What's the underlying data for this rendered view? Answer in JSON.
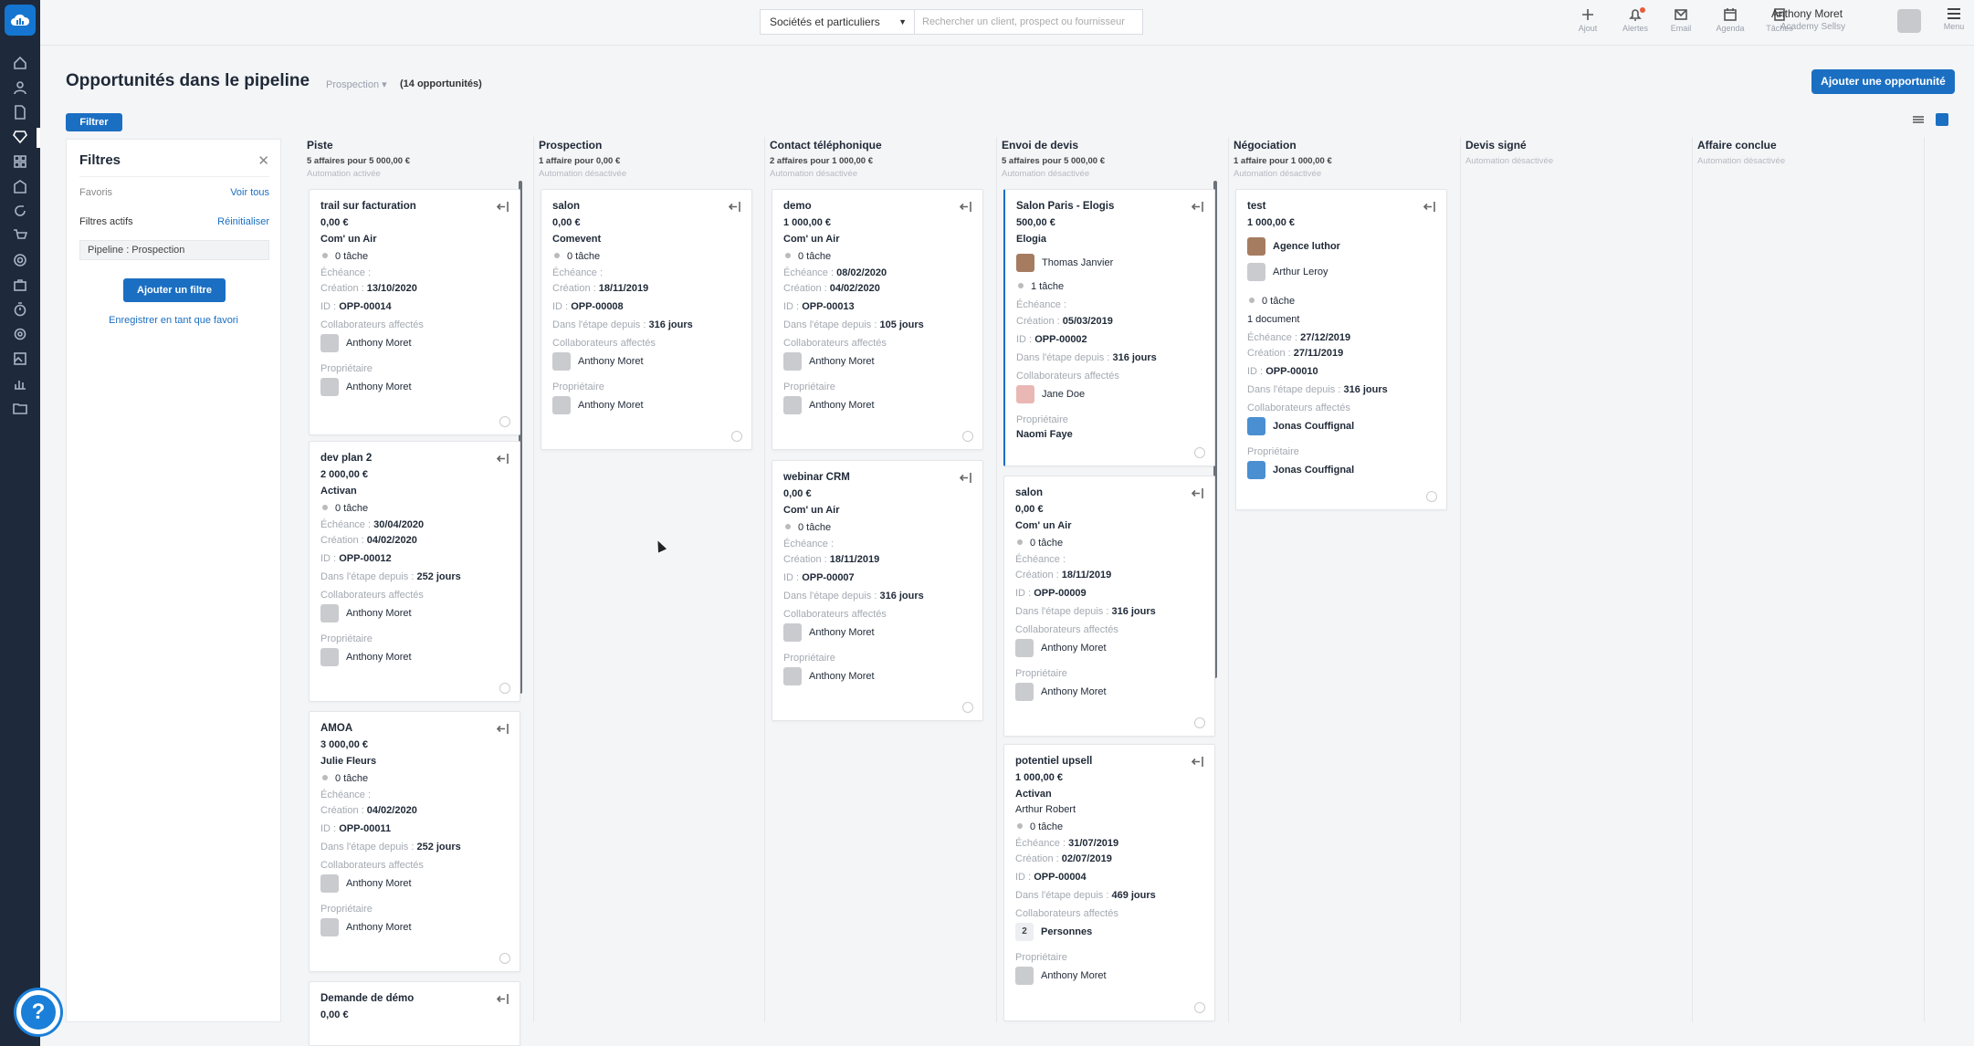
{
  "topbar": {
    "scope_select": "Sociétés et particuliers",
    "search_placeholder": "Rechercher un client, prospect ou fournisseur",
    "buttons": [
      {
        "label": "Ajout",
        "icon": "plus-icon"
      },
      {
        "label": "Alertes",
        "icon": "bell-icon"
      },
      {
        "label": "Email",
        "icon": "mail-icon"
      },
      {
        "label": "Agenda",
        "icon": "calendar-icon"
      },
      {
        "label": "Tâches",
        "icon": "tasks-icon"
      }
    ],
    "user_name": "Anthony Moret",
    "user_sub": "Academy Sellsy",
    "menu_label": "Menu"
  },
  "page": {
    "title": "Opportunités dans le pipeline",
    "pipeline_select": "Prospection",
    "count": "(14 opportunités)",
    "add_button": "Ajouter une opportunité",
    "filter_button": "Filtrer"
  },
  "filters": {
    "title": "Filtres",
    "favorites_label": "Favoris",
    "see_all": "Voir tous",
    "active_label": "Filtres actifs",
    "reset": "Réinitialiser",
    "active_tag": "Pipeline : Prospection",
    "add_filter": "Ajouter un filtre",
    "save_favorite": "Enregistrer en tant que favori"
  },
  "labels": {
    "tasks": "0 tâche",
    "one_task": "1 tâche",
    "echeance": "Échéance :",
    "creation": "Création :",
    "id": "ID :",
    "stage_since": "Dans l'étape depuis :",
    "collaborators": "Collaborateurs affectés",
    "owner": "Propriétaire",
    "one_document": "1 document"
  },
  "columns": [
    {
      "name": "Piste",
      "stats": "5 affaires pour 5 000,00 €",
      "auto": "Automation activée"
    },
    {
      "name": "Prospection",
      "stats": "1 affaire pour 0,00 €",
      "auto": "Automation désactivée"
    },
    {
      "name": "Contact téléphonique",
      "stats": "2 affaires pour 1 000,00 €",
      "auto": "Automation désactivée"
    },
    {
      "name": "Envoi de devis",
      "stats": "5 affaires pour 5 000,00 €",
      "auto": "Automation désactivée"
    },
    {
      "name": "Négociation",
      "stats": "1 affaire pour 1 000,00 €",
      "auto": "Automation désactivée"
    },
    {
      "name": "Devis signé",
      "stats": "",
      "auto": "Automation désactivée"
    },
    {
      "name": "Affaire conclue",
      "stats": "",
      "auto": "Automation désactivée"
    }
  ],
  "cards": {
    "c1": {
      "title": "trail sur facturation",
      "amount": "0,00 €",
      "company": "Com' un Air",
      "creation": "13/10/2020",
      "id": "OPP-00014",
      "collab": "Anthony Moret",
      "owner": "Anthony Moret"
    },
    "c2": {
      "title": "dev plan 2",
      "amount": "2 000,00 €",
      "company": "Activan",
      "echeance": "30/04/2020",
      "creation": "04/02/2020",
      "id": "OPP-00012",
      "since": "252 jours",
      "collab": "Anthony Moret",
      "owner": "Anthony Moret"
    },
    "c3": {
      "title": "AMOA",
      "amount": "3 000,00 €",
      "company": "Julie Fleurs",
      "creation": "04/02/2020",
      "id": "OPP-00011",
      "since": "252 jours",
      "collab": "Anthony Moret",
      "owner": "Anthony Moret"
    },
    "c4": {
      "title": "Demande de démo",
      "amount": "0,00 €"
    },
    "p1": {
      "title": "salon",
      "amount": "0,00 €",
      "company": "Comevent",
      "creation": "18/11/2019",
      "id": "OPP-00008",
      "since": "316 jours",
      "collab": "Anthony Moret",
      "owner": "Anthony Moret"
    },
    "t1": {
      "title": "demo",
      "amount": "1 000,00 €",
      "company": "Com' un Air",
      "echeance": "08/02/2020",
      "creation": "04/02/2020",
      "id": "OPP-00013",
      "since": "105 jours",
      "collab": "Anthony Moret",
      "owner": "Anthony Moret"
    },
    "t2": {
      "title": "webinar CRM",
      "amount": "0,00 €",
      "company": "Com' un Air",
      "creation": "18/11/2019",
      "id": "OPP-00007",
      "since": "316 jours",
      "collab": "Anthony Moret",
      "owner": "Anthony Moret"
    },
    "d1": {
      "title": "Salon Paris - Elogis",
      "amount": "500,00 €",
      "company": "Elogia",
      "contact": "Thomas Janvier",
      "creation": "05/03/2019",
      "id": "OPP-00002",
      "since": "316 jours",
      "collab": "Jane Doe",
      "owner": "Naomi Faye"
    },
    "d2": {
      "title": "salon",
      "amount": "0,00 €",
      "company": "Com' un Air",
      "creation": "18/11/2019",
      "id": "OPP-00009",
      "since": "316 jours",
      "collab": "Anthony Moret",
      "owner": "Anthony Moret"
    },
    "d3": {
      "title": "potentiel upsell",
      "amount": "1 000,00 €",
      "company": "Activan",
      "contact": "Arthur Robert",
      "echeance": "31/07/2019",
      "creation": "02/07/2019",
      "id": "OPP-00004",
      "since": "469 jours",
      "collab_count": "2",
      "collab": "Personnes",
      "owner": "Anthony Moret"
    },
    "n1": {
      "title": "test",
      "amount": "1 000,00 €",
      "company": "Agence luthor",
      "contact": "Arthur Leroy",
      "echeance": "27/12/2019",
      "creation": "27/11/2019",
      "id": "OPP-00010",
      "since": "316 jours",
      "collab": "Jonas Couffignal",
      "owner": "Jonas Couffignal"
    }
  }
}
